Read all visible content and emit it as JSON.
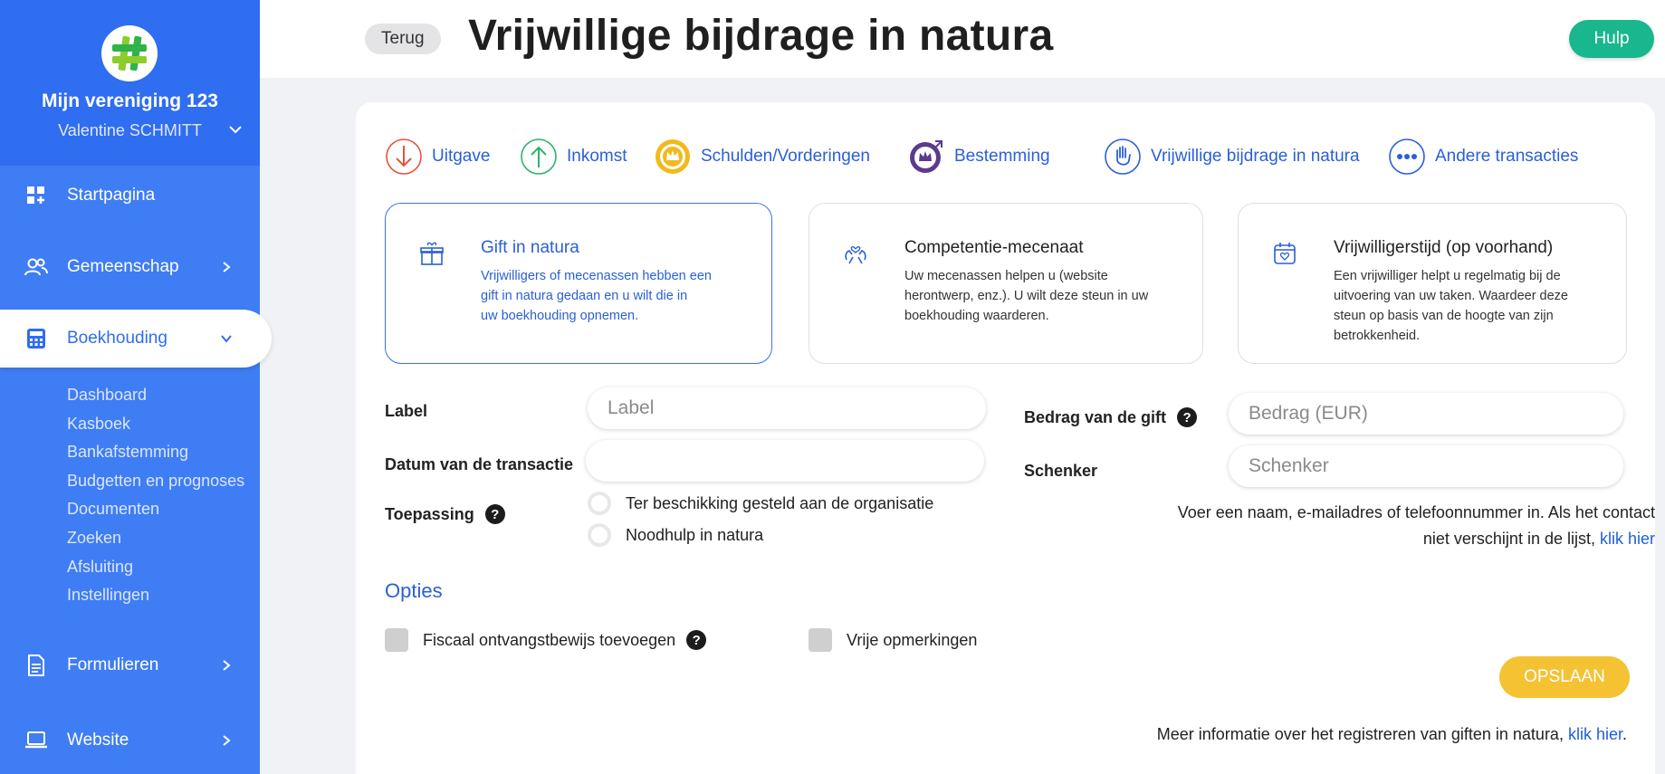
{
  "sidebar": {
    "org_name": "Mijn vereniging 123",
    "user_name": "Valentine SCHMITT",
    "nav": [
      {
        "label": "Startpagina"
      },
      {
        "label": "Gemeenschap"
      },
      {
        "label": "Boekhouding"
      },
      {
        "label": "Formulieren"
      },
      {
        "label": "Website"
      }
    ],
    "sub_items": [
      "Dashboard",
      "Kasboek",
      "Bankafstemming",
      "Budgetten en prognoses",
      "Documenten",
      "Zoeken",
      "Afsluiting",
      "Instellingen"
    ]
  },
  "header": {
    "back_label": "Terug",
    "title": "Vrijwillige bijdrage in natura",
    "help_label": "Hulp"
  },
  "tabs": [
    {
      "label": "Uitgave",
      "icon": "arrow-down-icon",
      "color": "#e5533d"
    },
    {
      "label": "Inkomst",
      "icon": "arrow-up-icon",
      "color": "#2cb36b"
    },
    {
      "label": "Schulden/Vorderingen",
      "icon": "crown-coin-icon",
      "color": "#f2b91c"
    },
    {
      "label": "Bestemming",
      "icon": "crown-transfer-icon",
      "color": "#5b3b8c"
    },
    {
      "label": "Vrijwillige bijdrage in natura",
      "icon": "hand-icon",
      "color": "#2a5fd7"
    },
    {
      "label": "Andere transacties",
      "icon": "more-dots-icon",
      "color": "#2a5fd7"
    }
  ],
  "option_cards": [
    {
      "title": "Gift in natura",
      "desc_lines": [
        "Vrijwilligers of mecenassen hebben een",
        "gift in natura gedaan en u wilt die in",
        "uw boekhouding opnemen."
      ],
      "icon": "gift-icon"
    },
    {
      "title": "Competentie-mecenaat",
      "desc_lines": [
        "Uw mecenassen helpen u (website",
        "herontwerp, enz.). U wilt deze steun in uw",
        "boekhouding waarderen."
      ],
      "icon": "helping-hands-icon"
    },
    {
      "title": "Vrijwilligerstijd (op voorhand)",
      "desc_lines": [
        "Een vrijwilliger helpt u regelmatig bij de",
        "uitvoering van uw taken. Waardeer deze",
        "steun op basis van de hoogte van zijn",
        "betrokkenheid."
      ],
      "icon": "calendar-heart-icon"
    }
  ],
  "form": {
    "label_label": "Label",
    "label_placeholder": "Label",
    "date_label": "Datum van de transactie",
    "date_value": "",
    "usage_label": "Toepassing",
    "usage_options": [
      "Ter beschikking gesteld aan de organisatie",
      "Noodhulp in natura"
    ],
    "amount_label": "Bedrag van de gift",
    "amount_placeholder": "Bedrag (EUR)",
    "donor_label": "Schenker",
    "donor_placeholder": "Schenker",
    "donor_hint_1": "Voer een naam, e-mailadres of telefoonnummer in. Als het contact",
    "donor_hint_2": "niet verschijnt in de lijst, ",
    "donor_hint_link": "klik hier"
  },
  "options": {
    "title": "Opties",
    "fiscal_receipt": "Fiscaal ontvangstbewijs toevoegen",
    "free_notes": "Vrije opmerkingen"
  },
  "save_label": "OPSLAAN",
  "more_info": {
    "text": "Meer informatie over het registreren van giften in natura, ",
    "link": "klik hier",
    "suffix": "."
  }
}
